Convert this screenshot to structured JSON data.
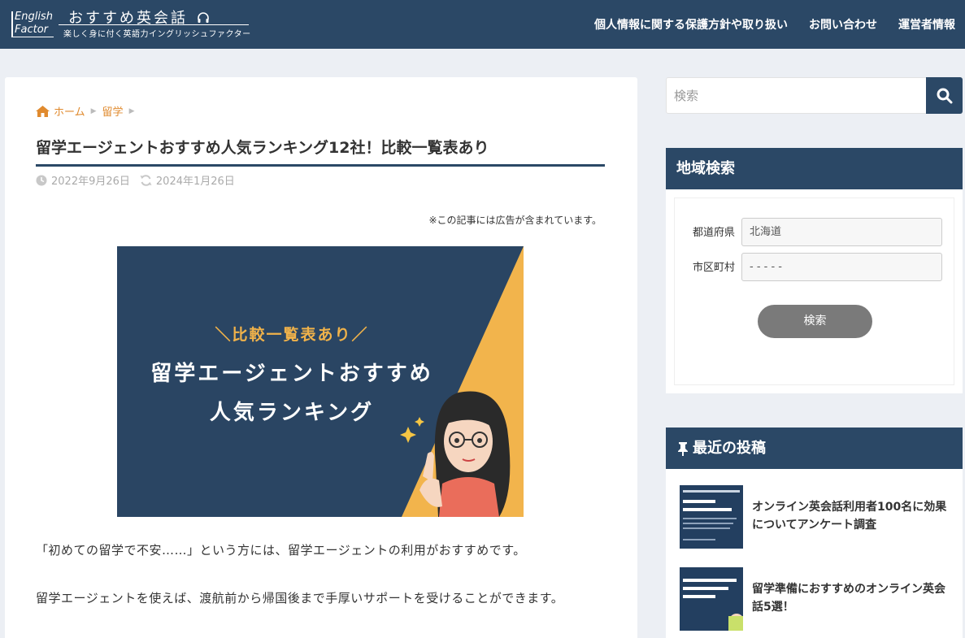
{
  "header": {
    "logo_line1": "English",
    "logo_line2": "Factor",
    "site_title": "おすすめ英会話",
    "site_subtitle": "楽しく身に付く英語力イングリッシュファクター",
    "nav": [
      {
        "label": "個人情報に関する保護方針や取り扱い"
      },
      {
        "label": "お問い合わせ"
      },
      {
        "label": "運営者情報"
      }
    ]
  },
  "breadcrumb": [
    {
      "label": "ホーム"
    },
    {
      "label": "留学"
    }
  ],
  "article": {
    "title": "留学エージェントおすすめ人気ランキング12社！比較一覧表あり",
    "published": "2022年9月26日",
    "updated": "2024年1月26日",
    "ad_note": "※この記事には広告が含まれています。",
    "hero": {
      "kicker": "＼比較一覧表あり／",
      "line1": "留学エージェントおすすめ",
      "line2": "人気ランキング"
    },
    "paragraphs": [
      "「初めての留学で不安……」という方には、留学エージェントの利用がおすすめです。",
      "留学エージェントを使えば、渡航前から帰国後まで手厚いサポートを受けることができます。"
    ]
  },
  "sidebar": {
    "search_placeholder": "検索",
    "region": {
      "heading": "地域検索",
      "prefecture_label": "都道府県",
      "prefecture_value": "北海道",
      "city_label": "市区町村",
      "city_value": "- - - - -",
      "button": "検索"
    },
    "recent": {
      "heading": "最近の投稿",
      "posts": [
        {
          "title": "オンライン英会話利用者100名に効果についてアンケート調査"
        },
        {
          "title": "留学準備におすすめのオンライン英会話5選！"
        }
      ]
    }
  },
  "colors": {
    "header_bg": "#2b4866",
    "accent_orange": "#e08a2e",
    "page_bg": "#eceff4"
  }
}
